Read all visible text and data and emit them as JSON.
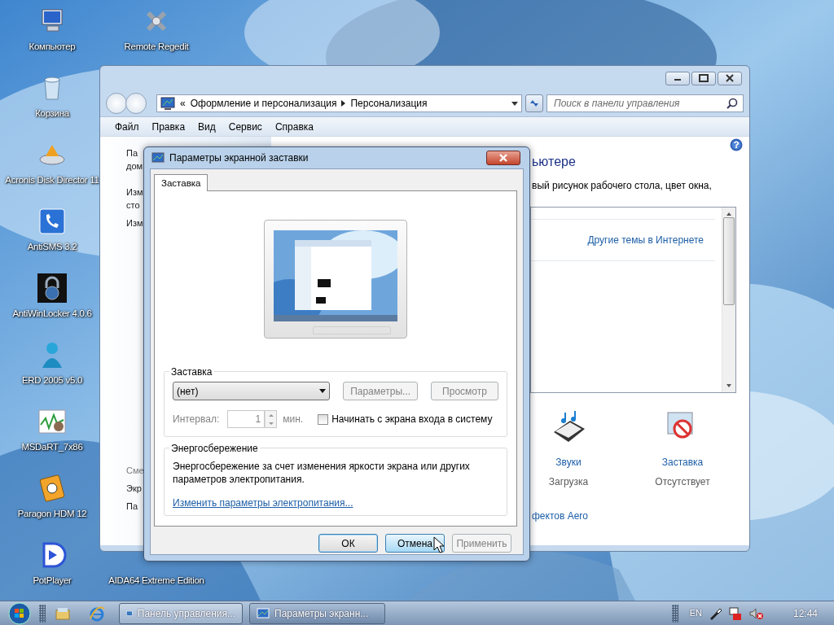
{
  "desktop_icons": [
    {
      "label": "Компьютер",
      "kind": "computer"
    },
    {
      "label": "Корзина",
      "kind": "bin"
    },
    {
      "label": "Acronis Disk Director 11",
      "kind": "disk"
    },
    {
      "label": "AntiSMS 3.2",
      "kind": "phone"
    },
    {
      "label": "AntiWinLocker 4.0.6",
      "kind": "padlock"
    },
    {
      "label": "ERD 2005 v5.0",
      "kind": "figure"
    },
    {
      "label": "MSDaRT_7x86",
      "kind": "chart"
    },
    {
      "label": "Paragon HDM 12",
      "kind": "drive"
    },
    {
      "label": "PotPlayer",
      "kind": "play"
    }
  ],
  "desktop_icons_column_2": [
    {
      "label": "Remote Regedit",
      "kind": "regedit"
    },
    {
      "label": "AIDA64 Extreme Edition",
      "kind": "covered"
    }
  ],
  "control_panel": {
    "breadcrumb_prefix": "«",
    "breadcrumb": [
      "Оформление и персонализация",
      "Персонализация"
    ],
    "search": {
      "placeholder": "Поиск в панели управления"
    },
    "menu": [
      "Файл",
      "Правка",
      "Вид",
      "Сервис",
      "Справка"
    ],
    "sidebar_top": [
      "Па",
      "дом",
      "Изм",
      "сто",
      "Изм"
    ],
    "sidebar_bottom": [
      {
        "text": "Сме",
        "kind": "heading"
      },
      {
        "text": "Экр",
        "kind": "link"
      },
      {
        "text": "Па",
        "kind": "link"
      }
    ],
    "heading_fragment": "ьютере",
    "description_fragment": "вый рисунок рабочего стола, цвет окна,",
    "themes_link": "Другие темы в Интернете",
    "bottom_items": [
      {
        "kind": "sounds",
        "label": "Звуки",
        "value": "Загрузка"
      },
      {
        "kind": "screensaver",
        "label": "Заставка",
        "value": "Отсутствует"
      }
    ],
    "aero_fragment": "фектов Aero"
  },
  "dialog": {
    "title": "Параметры экранной заставки",
    "tabs": [
      {
        "label": "Заставка",
        "selected": true
      }
    ],
    "screensaver_group": {
      "legend": "Заставка",
      "select_value": "(нет)",
      "buttons": [
        {
          "label": "Параметры...",
          "disabled": true
        },
        {
          "label": "Просмотр",
          "disabled": true
        }
      ],
      "interval_label": "Интервал:",
      "interval_value": "1",
      "interval_unit": "мин.",
      "interval_disabled": true,
      "checkbox": {
        "label": "Начинать с экрана входа в систему",
        "checked": false
      }
    },
    "power_group": {
      "legend": "Энергосбережение",
      "text": "Энергосбережение за счет изменения яркости экрана или других параметров электропитания.",
      "link": "Изменить параметры электропитания..."
    },
    "buttons": [
      {
        "label": "ОК",
        "default": true,
        "hovered": false,
        "disabled": false
      },
      {
        "label": "Отмена",
        "default": false,
        "hovered": true,
        "disabled": false
      },
      {
        "label": "Применить",
        "default": false,
        "hovered": false,
        "disabled": true
      }
    ]
  },
  "taskbar": {
    "tasks": [
      {
        "label": "Панель управления...",
        "selected": false
      },
      {
        "label": "Параметры экранн...",
        "selected": true
      }
    ],
    "language": "EN",
    "clock": "12:44"
  }
}
